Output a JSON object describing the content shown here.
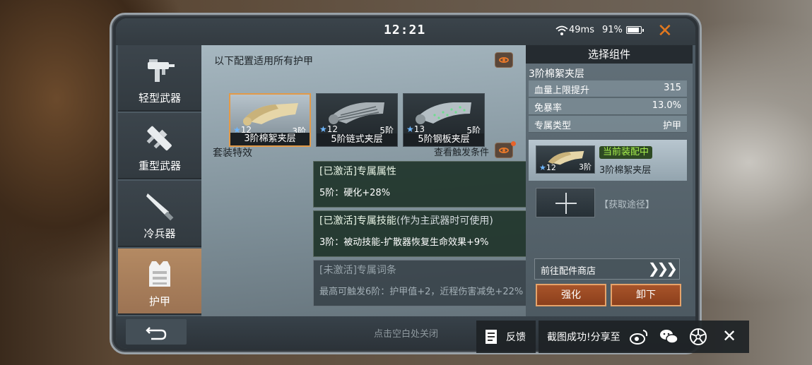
{
  "status": {
    "time": "12:21",
    "ping": "49ms",
    "battery": "91%",
    "battery_level": 0.91
  },
  "sidebar": {
    "items": [
      {
        "label": "轻型武器",
        "icon": "smg-icon",
        "active": false
      },
      {
        "label": "重型武器",
        "icon": "launcher-icon",
        "active": false
      },
      {
        "label": "冷兵器",
        "icon": "blade-icon",
        "active": false
      },
      {
        "label": "护甲",
        "icon": "vest-icon",
        "active": true
      }
    ]
  },
  "config": {
    "title": "以下配置适用所有护甲",
    "cards": [
      {
        "star": "★",
        "level": "12",
        "tier": "3阶",
        "name": "3阶棉絮夹层",
        "selected": true
      },
      {
        "star": "★",
        "level": "12",
        "tier": "5阶",
        "name": "5阶链式夹层",
        "selected": false
      },
      {
        "star": "★",
        "level": "13",
        "tier": "5阶",
        "name": "5阶钢板夹层",
        "selected": false
      }
    ]
  },
  "set_effects": {
    "title": "套装特效",
    "view_link": "查看触发条件",
    "items": [
      {
        "header": "[已激活]专属属性",
        "sub": "",
        "body": "5阶：硬化+28%",
        "active": true,
        "dots": "◆◆"
      },
      {
        "header": "[已激活]专属技能",
        "sub": "(作为主武器时可使用)",
        "body": "3阶：被动技能-扩散器恢复生命效果+9%",
        "active": true,
        "dots": "◆◆◆"
      },
      {
        "header": "[未激活]专属词条",
        "sub": "",
        "body": "最高可触发6阶：护甲值+2，近程伤害减免+22%",
        "active": false,
        "dots": "◆◆◆"
      }
    ]
  },
  "component": {
    "title": "选择组件",
    "name": "3阶棉絮夹层",
    "stats": [
      {
        "key": "血量上限提升",
        "value": "315"
      },
      {
        "key": "免暴率",
        "value": "13.0%"
      },
      {
        "key": "专属类型",
        "value": "护甲"
      }
    ],
    "equipped_badge": "当前装配中",
    "equipped_name": "3阶棉絮夹层",
    "equipped_star": "★",
    "equipped_level": "12",
    "equipped_tier": "3阶",
    "get_link": "【获取途径】",
    "shop_label": "前往配件商店",
    "shop_arrows": "❯❯❯",
    "enhance": "强化",
    "unequip": "卸下"
  },
  "bottom": {
    "hint": "点击空白处关闭"
  },
  "share": {
    "feedback": "反馈",
    "text": "截图成功!分享至",
    "targets": [
      "weibo-icon",
      "wechat-icon",
      "moments-icon"
    ]
  },
  "colors": {
    "accent": "#e2781f",
    "active_tab": "#b48a63",
    "equipped_badge": "#a6ee4d",
    "star": "#6fb7ff"
  }
}
